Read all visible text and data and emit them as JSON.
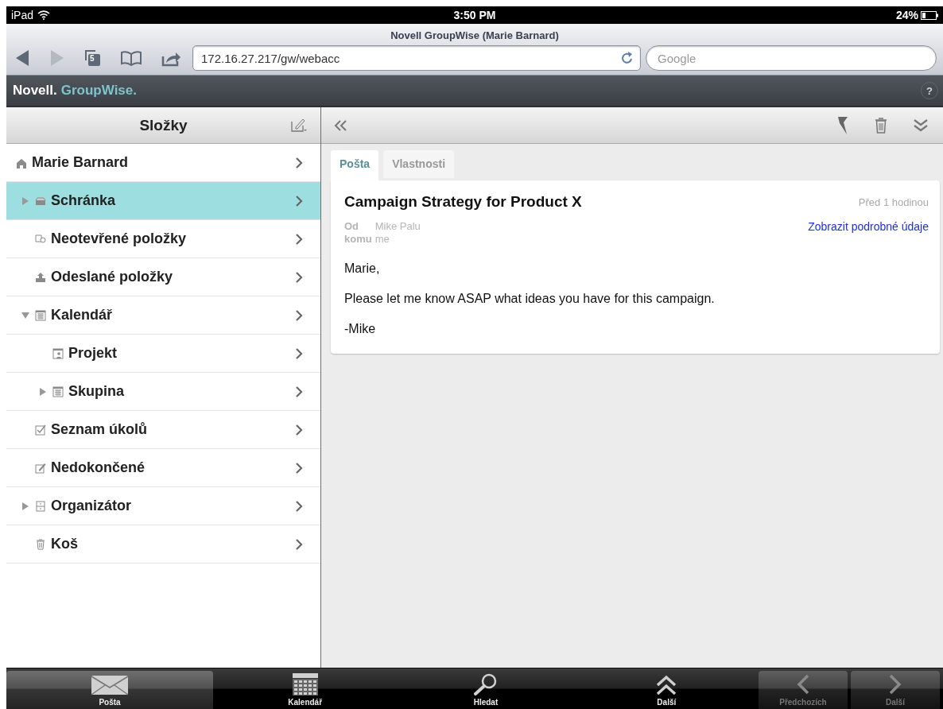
{
  "status_bar": {
    "device": "iPad",
    "time": "3:50 PM",
    "battery": "24%"
  },
  "browser": {
    "title": "Novell GroupWise (Marie Barnard)",
    "tab_count": "5",
    "url": "172.16.27.217/gw/webacc",
    "search": {
      "placeholder": "Google"
    }
  },
  "app_header": {
    "brand": "Novell.",
    "product": "GroupWise.",
    "help": "?"
  },
  "folders": {
    "title": "Složky",
    "items": [
      {
        "label": "Marie Barnard",
        "kind": "home",
        "selected": false,
        "children": [
          {
            "label": "Schránka",
            "kind": "inbox",
            "selected": true,
            "expanded": false
          },
          {
            "label": "Neotevřené položky",
            "kind": "unopened",
            "selected": false
          },
          {
            "label": "Odeslané položky",
            "kind": "sent",
            "selected": false
          },
          {
            "label": "Kalendář",
            "kind": "calendar",
            "selected": false,
            "expanded": true,
            "children": [
              {
                "label": "Projekt",
                "kind": "project",
                "selected": false
              },
              {
                "label": "Skupina",
                "kind": "calendar",
                "selected": false,
                "expanded": false
              }
            ]
          },
          {
            "label": "Seznam úkolů",
            "kind": "tasks",
            "selected": false
          },
          {
            "label": "Nedokončené",
            "kind": "drafts",
            "selected": false
          },
          {
            "label": "Organizátor",
            "kind": "cabinet",
            "selected": false,
            "expanded": false
          },
          {
            "label": "Koš",
            "kind": "trash",
            "selected": false
          }
        ]
      }
    ]
  },
  "message": {
    "tabs": [
      {
        "label": "Pošta",
        "selected": true
      },
      {
        "label": "Vlastnosti",
        "selected": false
      }
    ],
    "subject": "Campaign Strategy for Product X",
    "time": "Před 1 hodinou",
    "from_label": "Od",
    "from": "Mike Palu",
    "to_label": "komu",
    "to": "me",
    "details_link": "Zobrazit podrobné údaje",
    "body": [
      "Marie,",
      "Please let me know ASAP what ideas you have for this campaign.",
      "-Mike"
    ]
  },
  "tab_bar": [
    {
      "label": "Pošta",
      "kind": "mail",
      "selected": true,
      "disabled": false
    },
    {
      "label": "Kalendář",
      "kind": "calendar",
      "selected": false,
      "disabled": false
    },
    {
      "label": "Hledat",
      "kind": "search",
      "selected": false,
      "disabled": false
    },
    {
      "label": "Další",
      "kind": "more",
      "selected": false,
      "disabled": false
    },
    {
      "label": "Předchozích",
      "kind": "previous",
      "selected": false,
      "disabled": true
    },
    {
      "label": "Další",
      "kind": "next",
      "selected": false,
      "disabled": true
    }
  ]
}
